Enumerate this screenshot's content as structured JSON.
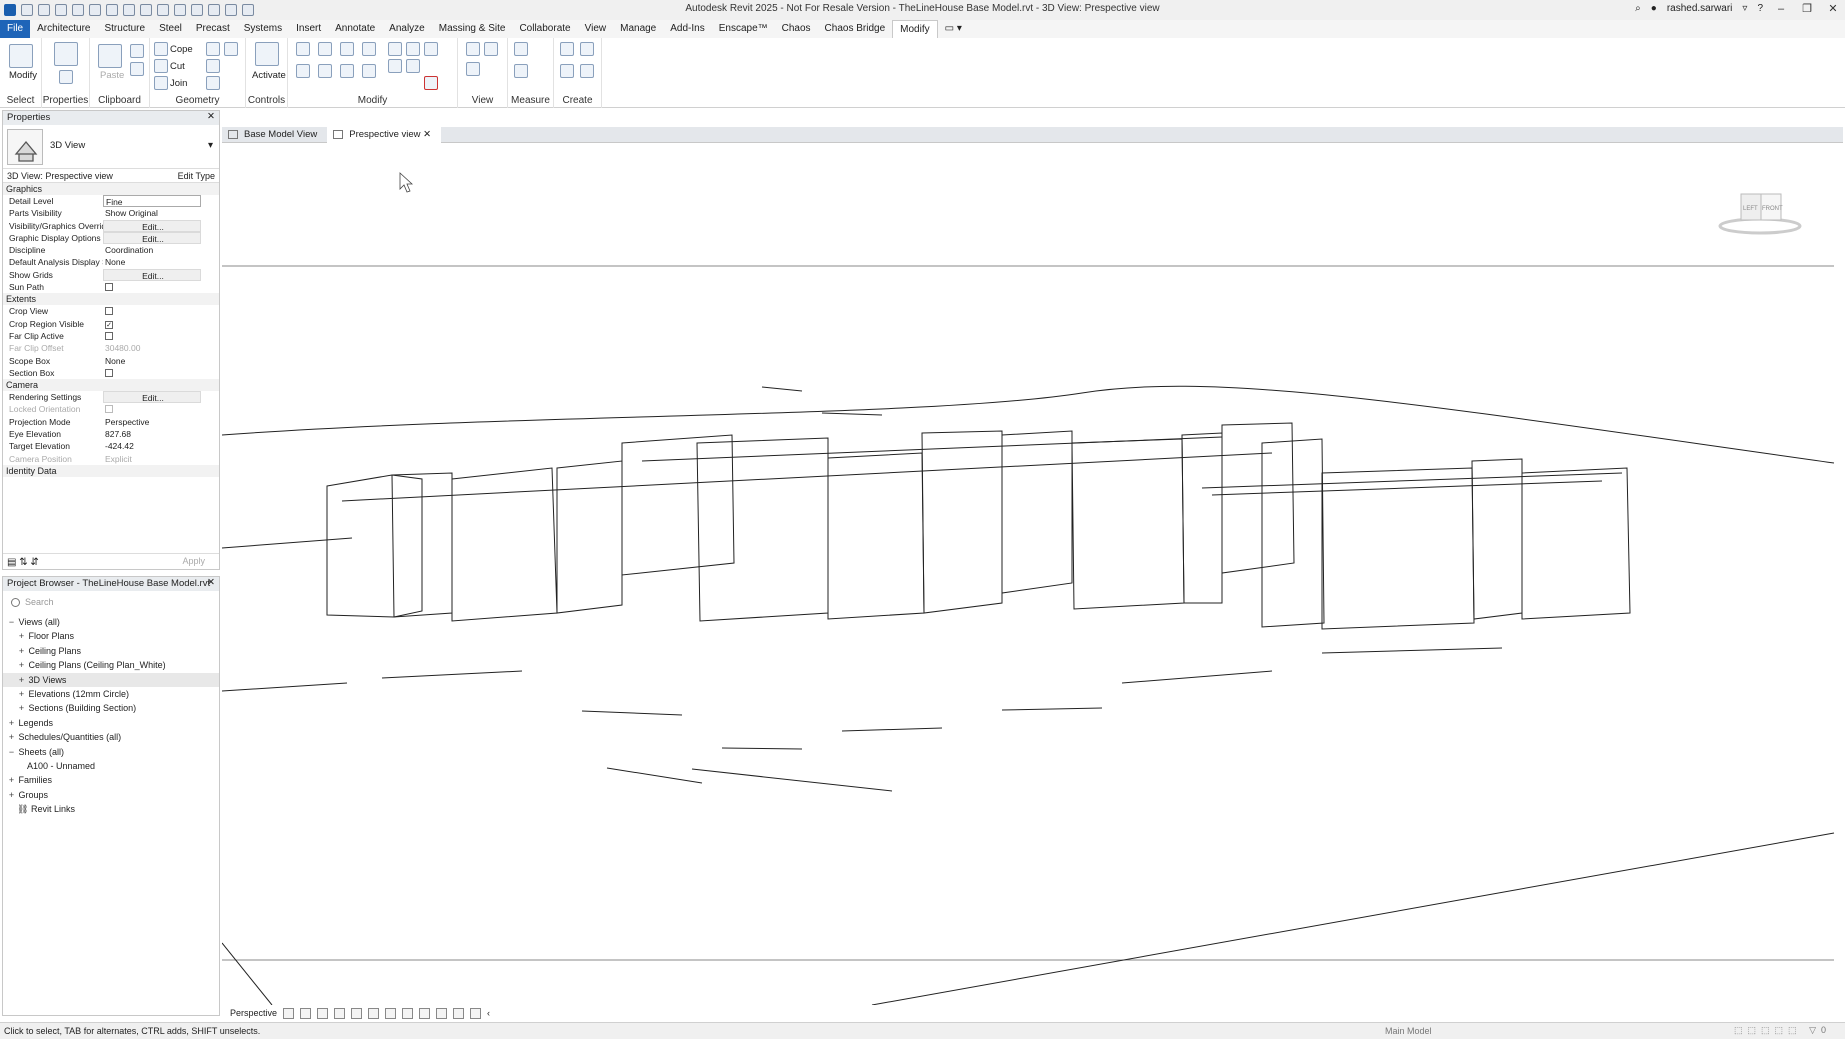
{
  "titlebar": {
    "title": "Autodesk Revit 2025 - Not For Resale Version - TheLineHouse Base Model.rvt - 3D View: Prespective view",
    "user": "rashed.sarwari"
  },
  "ribbon_tabs": [
    "File",
    "Architecture",
    "Structure",
    "Steel",
    "Precast",
    "Systems",
    "Insert",
    "Annotate",
    "Analyze",
    "Massing & Site",
    "Collaborate",
    "View",
    "Manage",
    "Add-Ins",
    "Enscape™",
    "Chaos",
    "Chaos Bridge",
    "Modify"
  ],
  "active_tab": "Modify",
  "ribbon": {
    "modify_label": "Modify",
    "select_label": "Select",
    "properties_label": "Properties",
    "paste_label": "Paste",
    "clipboard_label": "Clipboard",
    "cope_label": "Cope",
    "cut_label": "Cut",
    "join_label": "Join",
    "geometry_label": "Geometry",
    "activate_label": "Activate",
    "controls_label": "Controls",
    "modify_panel_label": "Modify",
    "view_label": "View",
    "measure_label": "Measure",
    "create_label": "Create"
  },
  "properties": {
    "header": "Properties",
    "type_name": "3D View",
    "instance": "3D View: Prespective view",
    "edit_type": "Edit Type",
    "apply": "Apply",
    "groups": {
      "graphics": "Graphics",
      "extents": "Extents",
      "camera": "Camera",
      "identity": "Identity Data"
    },
    "rows": {
      "detail_level": {
        "k": "Detail Level",
        "v": "Fine"
      },
      "parts_visibility": {
        "k": "Parts Visibility",
        "v": "Show Original"
      },
      "vg_overrides": {
        "k": "Visibility/Graphics Overrides",
        "v": "Edit..."
      },
      "gdo": {
        "k": "Graphic Display Options",
        "v": "Edit..."
      },
      "discipline": {
        "k": "Discipline",
        "v": "Coordination"
      },
      "analysis_style": {
        "k": "Default Analysis Display St...",
        "v": "None"
      },
      "show_grids": {
        "k": "Show Grids",
        "v": "Edit..."
      },
      "sun_path": {
        "k": "Sun Path",
        "v": ""
      },
      "crop_view": {
        "k": "Crop View",
        "v": ""
      },
      "crop_region_visible": {
        "k": "Crop Region Visible",
        "v": "✓"
      },
      "far_clip_active": {
        "k": "Far Clip Active",
        "v": ""
      },
      "far_clip_offset": {
        "k": "Far Clip Offset",
        "v": "30480.00"
      },
      "scope_box": {
        "k": "Scope Box",
        "v": "None"
      },
      "section_box": {
        "k": "Section Box",
        "v": ""
      },
      "rendering_settings": {
        "k": "Rendering Settings",
        "v": "Edit..."
      },
      "locked_orientation": {
        "k": "Locked Orientation",
        "v": ""
      },
      "projection_mode": {
        "k": "Projection Mode",
        "v": "Perspective"
      },
      "eye_elevation": {
        "k": "Eye Elevation",
        "v": "827.68"
      },
      "target_elevation": {
        "k": "Target Elevation",
        "v": "-424.42"
      },
      "camera_position": {
        "k": "Camera Position",
        "v": "Explicit"
      }
    }
  },
  "browser": {
    "header": "Project Browser - TheLineHouse Base Model.rvt",
    "search_placeholder": "Search",
    "nodes": [
      {
        "label": "Views (all)",
        "tog": "−"
      },
      {
        "label": "Floor Plans",
        "tog": "+"
      },
      {
        "label": "Ceiling Plans",
        "tog": "+"
      },
      {
        "label": "Ceiling Plans (Ceiling Plan_White)",
        "tog": "+"
      },
      {
        "label": "3D Views",
        "tog": "+"
      },
      {
        "label": "Elevations (12mm Circle)",
        "tog": "+"
      },
      {
        "label": "Sections (Building Section)",
        "tog": "+"
      },
      {
        "label": "Legends",
        "tog": "+"
      },
      {
        "label": "Schedules/Quantities (all)",
        "tog": "+"
      },
      {
        "label": "Sheets (all)",
        "tog": "−"
      },
      {
        "label": "A100 - Unnamed",
        "tog": ""
      },
      {
        "label": "Families",
        "tog": "+"
      },
      {
        "label": "Groups",
        "tog": "+"
      },
      {
        "label": "Revit Links",
        "tog": ""
      }
    ]
  },
  "doc_tabs": [
    "Base Model View",
    "Prespective view"
  ],
  "viewcube": {
    "left": "LEFT",
    "front": "FRONT"
  },
  "view_control": {
    "mode": "Perspective"
  },
  "status": {
    "message": "Click to select, TAB for alternates, CTRL adds, SHIFT unselects.",
    "model": "Main Model"
  }
}
